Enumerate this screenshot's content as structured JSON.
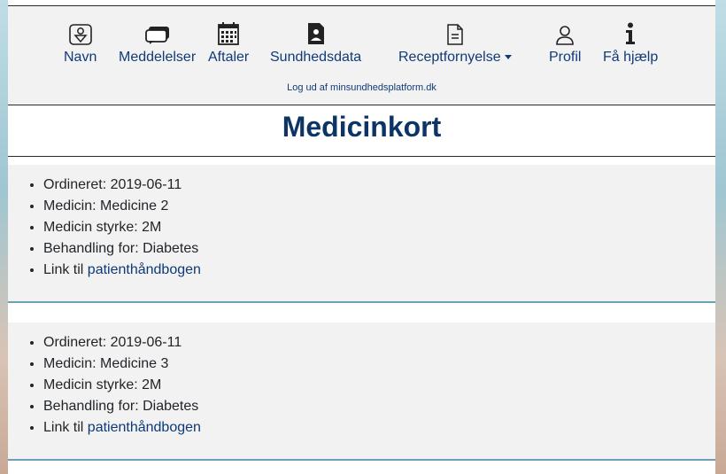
{
  "nav": {
    "items": [
      {
        "label": "Navn",
        "icon": "name-badge-icon"
      },
      {
        "label": "Meddelelser",
        "icon": "chat-bubbles-icon"
      },
      {
        "label": "Aftaler",
        "icon": "calendar-icon"
      },
      {
        "label": "Sundhedsdata",
        "icon": "health-document-icon"
      },
      {
        "label": "Receptfornyelse",
        "icon": "prescription-document-icon"
      },
      {
        "label": "Profil",
        "icon": "person-icon"
      },
      {
        "label": "Få hjælp",
        "icon": "info-icon"
      }
    ],
    "logout": "Log ud af minsundhedsplatform.dk"
  },
  "page": {
    "title": "Medicinkort"
  },
  "medications": [
    {
      "ordered": "Ordineret: 2019-06-11",
      "medicine": "Medicin: Medicine 2",
      "strength": "Medicin styrke: 2M",
      "treatment": "Behandling for: Diabetes",
      "link_prefix": "Link til ",
      "link_text": "patienthåndbogen"
    },
    {
      "ordered": "Ordineret: 2019-06-11",
      "medicine": "Medicin: Medicine 3",
      "strength": "Medicin styrke: 2M",
      "treatment": "Behandling for: Diabetes",
      "link_prefix": "Link til ",
      "link_text": "patienthåndbogen"
    }
  ],
  "colors": {
    "brand": "#103a78",
    "title": "#0c3566",
    "card_border": "#6f9fb3"
  }
}
